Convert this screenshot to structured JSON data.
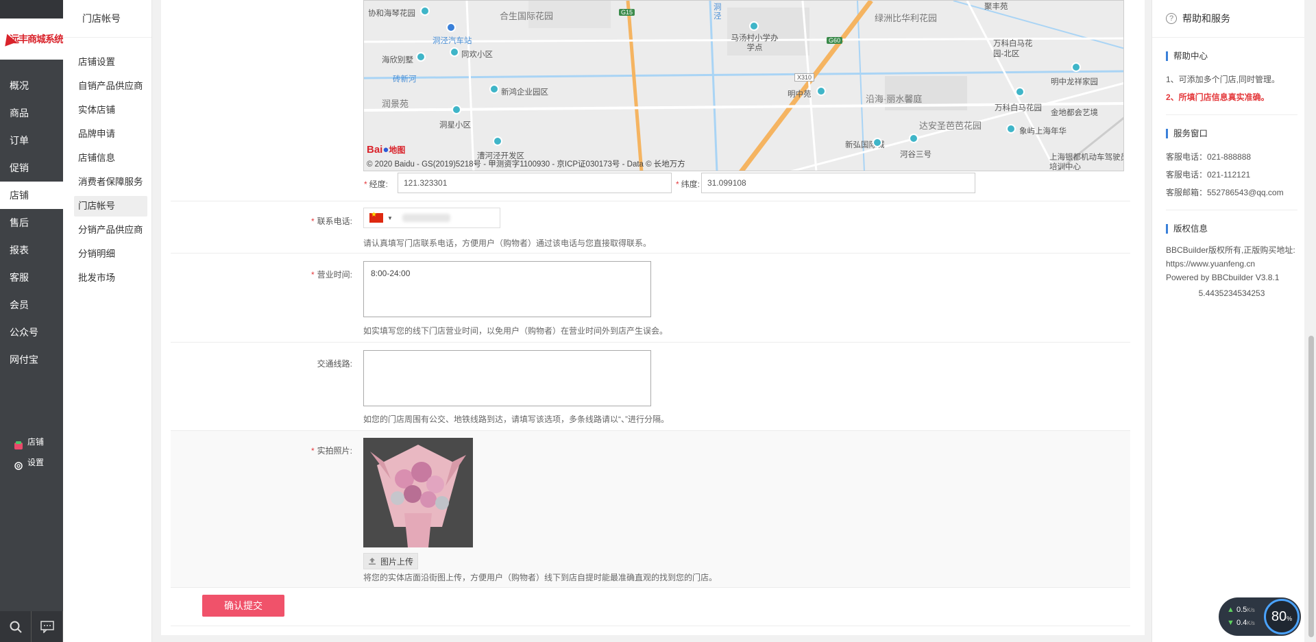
{
  "leftnav": {
    "logo_text": "远丰商城系统",
    "items": [
      "概况",
      "商品",
      "订单",
      "促销",
      "店铺",
      "售后",
      "报表",
      "客服",
      "会员",
      "公众号",
      "网付宝"
    ],
    "active_index": 4,
    "bottom": [
      "店铺",
      "设置"
    ]
  },
  "submenu": {
    "title": "门店帐号",
    "items": [
      "店铺设置",
      "自销产品供应商",
      "实体店铺",
      "品牌申请",
      "店铺信息",
      "消费者保障服务",
      "门店帐号",
      "分销产品供应商",
      "分销明细",
      "批发市场"
    ],
    "active_index": 6
  },
  "map": {
    "labels": [
      "协和海琴花园",
      "合生国际花园",
      "洞泾汽车站",
      "海欣别墅",
      "同欢小区",
      "砖新河",
      "新鸿企业园区",
      "润景苑",
      "洞星小区",
      "漕河泾开发区",
      "马汤村小学办学点",
      "明中苑",
      "沿海·丽水馨庭",
      "绿洲比华利花园",
      "聚丰苑",
      "万科白马花园-北区",
      "明中龙祥家园",
      "万科白马花园",
      "金地都会艺境",
      "达安圣芭芭花园",
      "象屿上海年华",
      "新弘国际城",
      "河谷三号",
      "上海银都机动车驾驶员培训中心",
      "G15",
      "G60",
      "X310",
      "洞泾"
    ],
    "copyright": "© 2020 Baidu - GS(2019)5218号 - 甲测资字1100930 - 京ICP证030173号 - Data © 长地万方",
    "logo_a": "Bai",
    "logo_b": "地图"
  },
  "form": {
    "longitude_label": "经度:",
    "longitude_value": "121.323301",
    "latitude_label": "纬度:",
    "latitude_value": "31.099108",
    "phone_label": "联系电话:",
    "phone_hint": "请认真填写门店联系电话，方便用户（购物者）通过该电话与您直接取得联系。",
    "hours_label": "营业时间:",
    "hours_value": "8:00-24:00",
    "hours_hint": "如实填写您的线下门店营业时间，以免用户（购物者）在营业时间外到店产生误会。",
    "traffic_label": "交通线路:",
    "traffic_value": "",
    "traffic_hint": "如您的门店周围有公交、地铁线路到达，请填写该选项，多条线路请以“、”进行分隔。",
    "photo_label": "实拍照片:",
    "upload_label": "图片上传",
    "photo_hint": "将您的实体店面沿街图上传，方便用户（购物者）线下到店自提时能最准确直观的找到您的门店。",
    "submit_label": "确认提交"
  },
  "right": {
    "title": "帮助和服务",
    "help_title": "帮助中心",
    "help_lines": [
      "1、可添加多个门店,同时管理。",
      "2、所填门店信息真实准确。"
    ],
    "service_title": "服务窗口",
    "service_lines": [
      "客服电话：021-888888",
      "客服电话：021-112121",
      "客服邮箱：552786543@qq.com"
    ],
    "copyright_title": "版权信息",
    "copyright_lines": [
      "BBCBuilder版权所有,正版购买地址:",
      "https://www.yuanfeng.cn",
      "Powered by BBCbuilder V3.8.1"
    ],
    "version": "5.4435234534253"
  },
  "netwidget": {
    "up": "0.5",
    "down": "0.4",
    "unit": "K/s",
    "percent": "80",
    "percent_sign": "%"
  }
}
